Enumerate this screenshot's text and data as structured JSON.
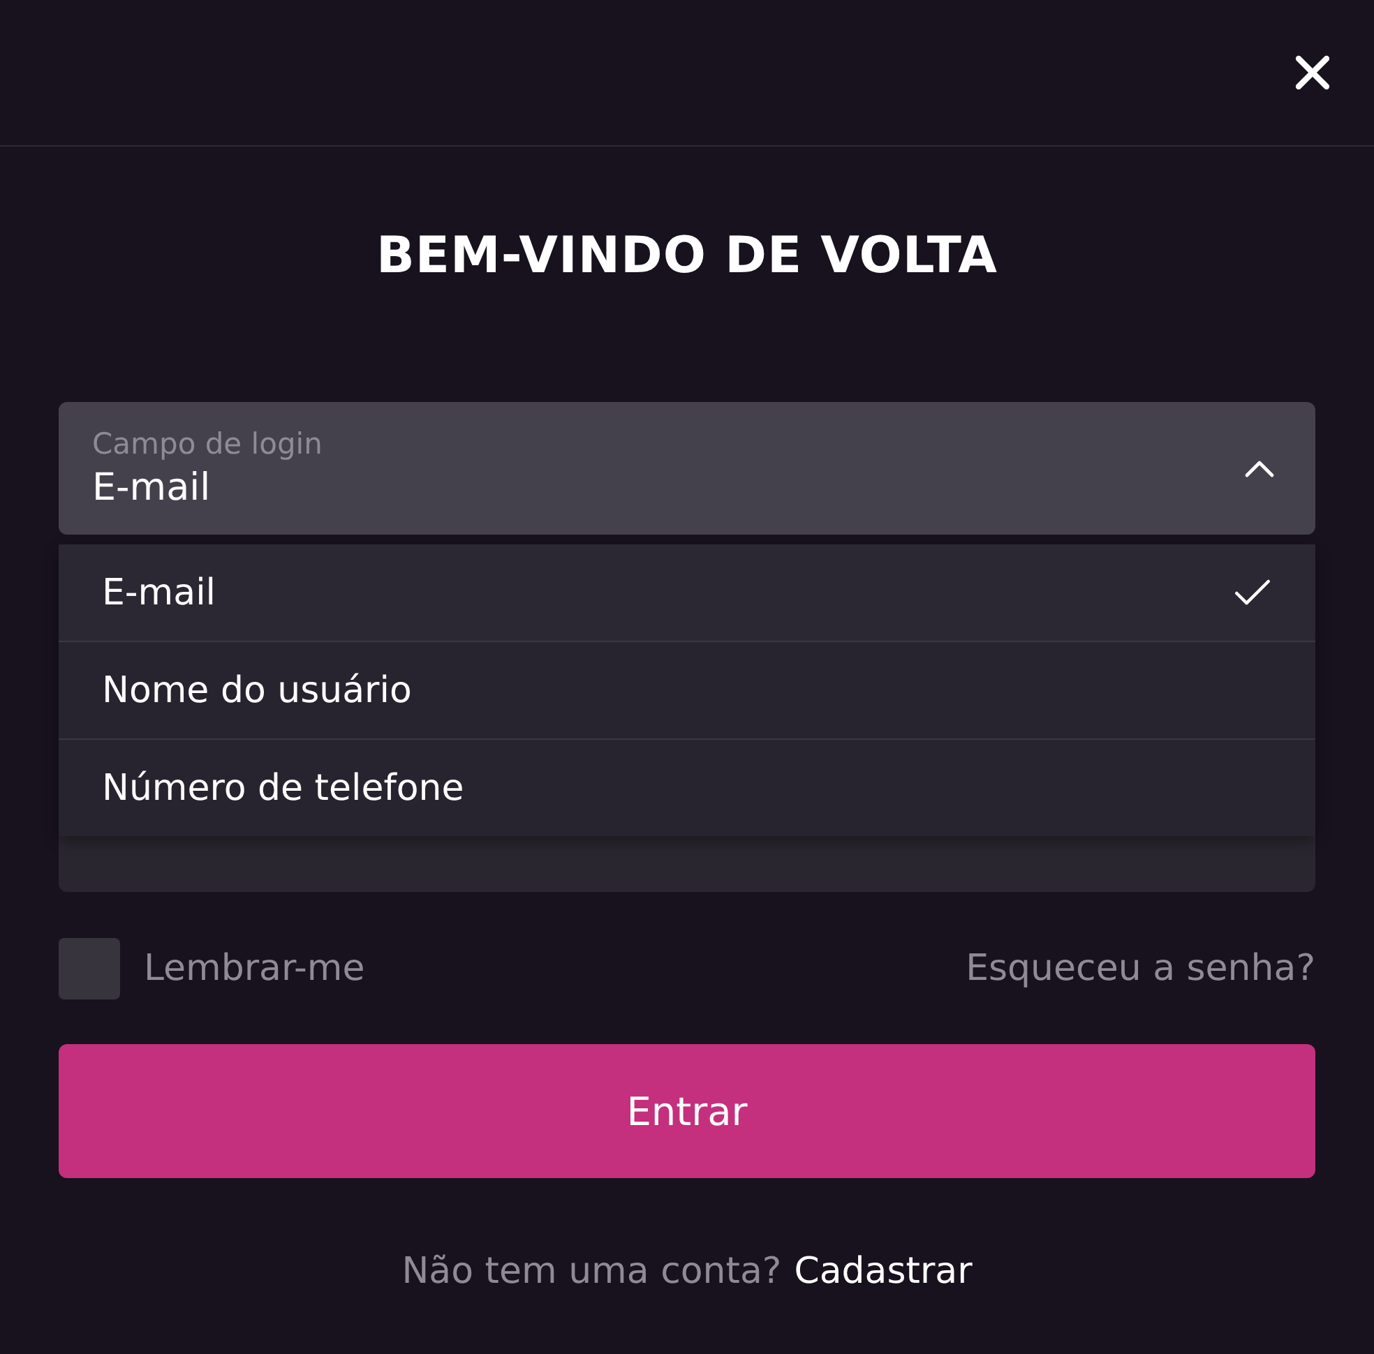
{
  "title": "BEM-VINDO DE VOLTA",
  "login_field": {
    "label": "Campo de login",
    "value": "E-mail",
    "expanded": true
  },
  "login_options": [
    {
      "label": "E-mail",
      "selected": true
    },
    {
      "label": "Nome do usuário",
      "selected": false
    },
    {
      "label": "Número de telefone",
      "selected": false
    }
  ],
  "remember": {
    "label": "Lembrar-me",
    "checked": false
  },
  "forgot_link": "Esqueceu a senha?",
  "submit_button": "Entrar",
  "footer": {
    "text": "Não tem uma conta?",
    "link": "Cadastrar"
  }
}
